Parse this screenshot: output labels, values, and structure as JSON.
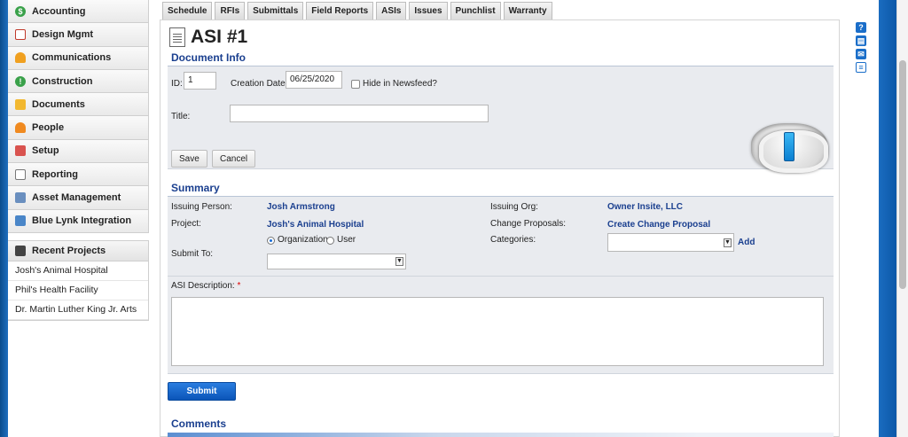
{
  "sidebar": {
    "items": [
      {
        "label": "Accounting",
        "icon": "accounting-icon"
      },
      {
        "label": "Design Mgmt",
        "icon": "design-icon"
      },
      {
        "label": "Communications",
        "icon": "communications-icon"
      },
      {
        "label": "Construction",
        "icon": "construction-icon"
      },
      {
        "label": "Documents",
        "icon": "folder-icon"
      },
      {
        "label": "People",
        "icon": "people-icon"
      },
      {
        "label": "Setup",
        "icon": "setup-icon"
      },
      {
        "label": "Reporting",
        "icon": "reporting-icon"
      },
      {
        "label": "Asset Management",
        "icon": "asset-icon"
      },
      {
        "label": "Blue Lynk Integration",
        "icon": "integration-icon"
      }
    ],
    "recent_title": "Recent Projects",
    "recent": [
      "Josh's Animal Hospital",
      "Phil's Health Facility",
      "Dr. Martin Luther King Jr. Arts"
    ]
  },
  "tabs": [
    "Schedule",
    "RFIs",
    "Submittals",
    "Field Reports",
    "ASIs",
    "Issues",
    "Punchlist",
    "Warranty"
  ],
  "page": {
    "title": "ASI #1"
  },
  "doc_info": {
    "title": "Document Info",
    "id_label": "ID:",
    "id_value": "1",
    "creation_label": "Creation Date:",
    "creation_value": "06/25/2020",
    "hide_label": "Hide in Newsfeed?",
    "title_label": "Title:",
    "title_value": "",
    "save": "Save",
    "cancel": "Cancel"
  },
  "summary": {
    "title": "Summary",
    "issuing_person_label": "Issuing Person:",
    "issuing_person": "Josh Armstrong",
    "issuing_org_label": "Issuing Org:",
    "issuing_org": "Owner Insite, LLC",
    "project_label": "Project:",
    "project": "Josh's Animal Hospital",
    "change_label": "Change Proposals:",
    "change_link": "Create Change Proposal",
    "radio_org": "Organization",
    "radio_user": "User",
    "categories_label": "Categories:",
    "add_label": "Add",
    "submit_to_label": "Submit To:",
    "asi_desc_label": "ASI Description:",
    "required_mark": "*"
  },
  "submit": "Submit",
  "comments": {
    "title": "Comments"
  },
  "right_icons": [
    "help-icon",
    "print-icon",
    "email-icon",
    "document-icon"
  ]
}
